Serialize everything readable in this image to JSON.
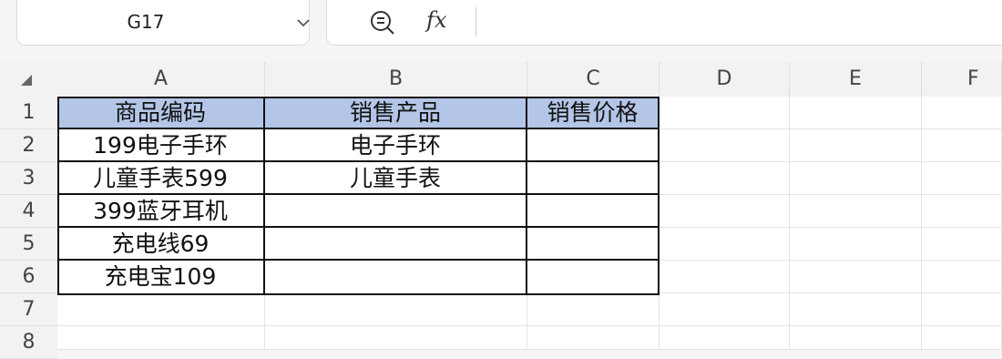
{
  "formula_bar": {
    "name_box": "G17",
    "zoom_icon": "zoom-formula-icon",
    "fx_label": "fx",
    "formula_value": ""
  },
  "columns": [
    "A",
    "B",
    "C",
    "D",
    "E",
    "F"
  ],
  "rows": [
    "1",
    "2",
    "3",
    "4",
    "5",
    "6",
    "7",
    "8"
  ],
  "table": {
    "header": [
      "商品编码",
      "销售产品",
      "销售价格"
    ],
    "rows": [
      [
        "199电子手环",
        "电子手环",
        ""
      ],
      [
        "儿童手表599",
        "儿童手表",
        ""
      ],
      [
        "399蓝牙耳机",
        "",
        ""
      ],
      [
        "充电线69",
        "",
        ""
      ],
      [
        "充电宝109",
        "",
        ""
      ]
    ],
    "header_fill": "#b4c6e7"
  }
}
